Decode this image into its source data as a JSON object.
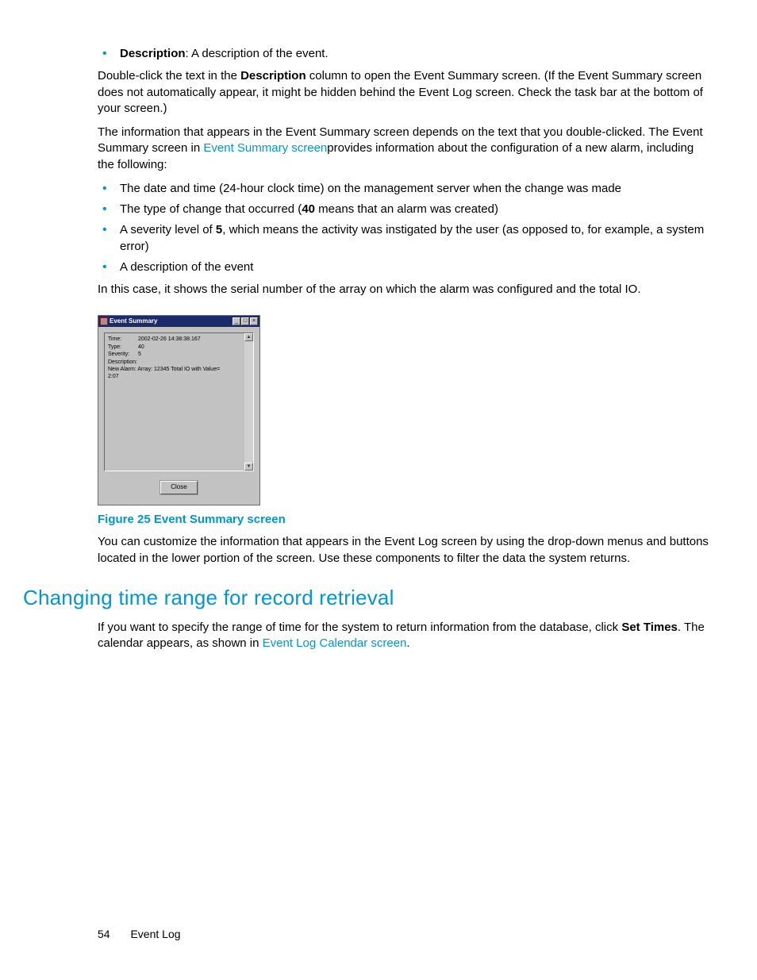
{
  "bullets_top": [
    {
      "term": "Description",
      "rest": ":  A description of the event."
    }
  ],
  "para1": {
    "t1": "Double-click the text in the ",
    "bold": "Description",
    "t2": " column to open the Event Summary screen.  (If the Event Summary screen does not automatically appear, it might be hidden behind the Event Log screen.  Check the task bar at the bottom of your screen.)"
  },
  "para2": {
    "t1": "The information that appears in the Event Summary screen depends on the text that you double-clicked. The Event Summary screen in ",
    "link": "Event Summary screen",
    "t2": "provides information about the configuration of a new alarm, including the following:"
  },
  "bullets_main": [
    {
      "text": "The date and time (24-hour clock time) on the management server when the change was made"
    },
    {
      "pre": "The type of change that occurred (",
      "bold": "40",
      "post": " means that an alarm was created)"
    },
    {
      "pre": "A severity level of ",
      "bold": "5",
      "post": ", which means the activity was instigated by the user (as opposed to, for example, a system error)"
    },
    {
      "text": "A description of the event"
    }
  ],
  "para3": "In this case, it shows the serial number of the array on which the alarm was configured and the total IO.",
  "figure": {
    "caption": "Figure 25 Event Summary screen",
    "window_title": "Event Summary",
    "close_label": "Close",
    "fields": {
      "time_label": "Time:",
      "time_value": "2002-02-26 14:38:38.167",
      "type_label": "Type:",
      "type_value": "40",
      "severity_label": "Severity:",
      "severity_value": "5",
      "desc_label": "Description:",
      "desc_line": "New Alarm: Array: 12345  Total IO with Value=",
      "desc_line2": "2:07"
    }
  },
  "para4": "You can customize the information that appears in the Event Log screen by using the drop-down menus and buttons located in the lower portion of the screen.  Use these components to filter the data the system returns.",
  "heading": "Changing time range for record retrieval",
  "para5": {
    "t1": "If you want to specify the range of time for the system to return information from the database, click ",
    "bold": "Set Times",
    "t2": ".  The calendar appears, as shown in ",
    "link": "Event Log Calendar screen",
    "t3": "."
  },
  "footer": {
    "page": "54",
    "section": "Event Log"
  }
}
